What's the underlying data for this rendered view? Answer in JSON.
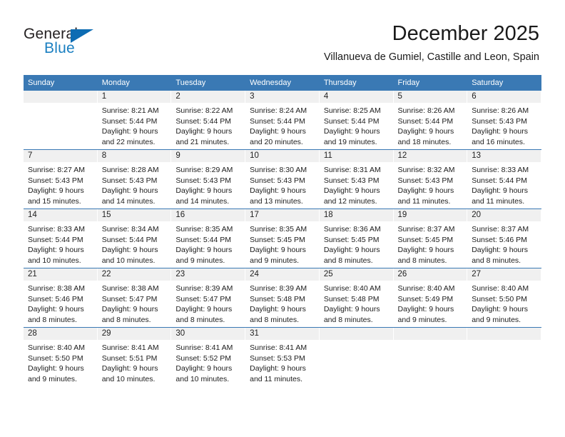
{
  "brand": {
    "word1": "General",
    "word2": "Blue",
    "triangle_color": "#0d6cb3",
    "word1_color": "#231f20",
    "word2_color": "#1a7fc1"
  },
  "header": {
    "title": "December 2025",
    "subtitle": "Villanueva de Gumiel, Castille and Leon, Spain"
  },
  "theme": {
    "header_blue": "#3a79b4",
    "daynum_band_gray": "#f0f0f0",
    "text_color": "#1c1c1c"
  },
  "calendar": {
    "weekday_headers": [
      "Sunday",
      "Monday",
      "Tuesday",
      "Wednesday",
      "Thursday",
      "Friday",
      "Saturday"
    ],
    "weeks": [
      [
        {
          "day": "",
          "sunrise": "",
          "sunset": "",
          "daylight1": "",
          "daylight2": ""
        },
        {
          "day": "1",
          "sunrise": "Sunrise: 8:21 AM",
          "sunset": "Sunset: 5:44 PM",
          "daylight1": "Daylight: 9 hours",
          "daylight2": "and 22 minutes."
        },
        {
          "day": "2",
          "sunrise": "Sunrise: 8:22 AM",
          "sunset": "Sunset: 5:44 PM",
          "daylight1": "Daylight: 9 hours",
          "daylight2": "and 21 minutes."
        },
        {
          "day": "3",
          "sunrise": "Sunrise: 8:24 AM",
          "sunset": "Sunset: 5:44 PM",
          "daylight1": "Daylight: 9 hours",
          "daylight2": "and 20 minutes."
        },
        {
          "day": "4",
          "sunrise": "Sunrise: 8:25 AM",
          "sunset": "Sunset: 5:44 PM",
          "daylight1": "Daylight: 9 hours",
          "daylight2": "and 19 minutes."
        },
        {
          "day": "5",
          "sunrise": "Sunrise: 8:26 AM",
          "sunset": "Sunset: 5:44 PM",
          "daylight1": "Daylight: 9 hours",
          "daylight2": "and 18 minutes."
        },
        {
          "day": "6",
          "sunrise": "Sunrise: 8:26 AM",
          "sunset": "Sunset: 5:43 PM",
          "daylight1": "Daylight: 9 hours",
          "daylight2": "and 16 minutes."
        }
      ],
      [
        {
          "day": "7",
          "sunrise": "Sunrise: 8:27 AM",
          "sunset": "Sunset: 5:43 PM",
          "daylight1": "Daylight: 9 hours",
          "daylight2": "and 15 minutes."
        },
        {
          "day": "8",
          "sunrise": "Sunrise: 8:28 AM",
          "sunset": "Sunset: 5:43 PM",
          "daylight1": "Daylight: 9 hours",
          "daylight2": "and 14 minutes."
        },
        {
          "day": "9",
          "sunrise": "Sunrise: 8:29 AM",
          "sunset": "Sunset: 5:43 PM",
          "daylight1": "Daylight: 9 hours",
          "daylight2": "and 14 minutes."
        },
        {
          "day": "10",
          "sunrise": "Sunrise: 8:30 AM",
          "sunset": "Sunset: 5:43 PM",
          "daylight1": "Daylight: 9 hours",
          "daylight2": "and 13 minutes."
        },
        {
          "day": "11",
          "sunrise": "Sunrise: 8:31 AM",
          "sunset": "Sunset: 5:43 PM",
          "daylight1": "Daylight: 9 hours",
          "daylight2": "and 12 minutes."
        },
        {
          "day": "12",
          "sunrise": "Sunrise: 8:32 AM",
          "sunset": "Sunset: 5:43 PM",
          "daylight1": "Daylight: 9 hours",
          "daylight2": "and 11 minutes."
        },
        {
          "day": "13",
          "sunrise": "Sunrise: 8:33 AM",
          "sunset": "Sunset: 5:44 PM",
          "daylight1": "Daylight: 9 hours",
          "daylight2": "and 11 minutes."
        }
      ],
      [
        {
          "day": "14",
          "sunrise": "Sunrise: 8:33 AM",
          "sunset": "Sunset: 5:44 PM",
          "daylight1": "Daylight: 9 hours",
          "daylight2": "and 10 minutes."
        },
        {
          "day": "15",
          "sunrise": "Sunrise: 8:34 AM",
          "sunset": "Sunset: 5:44 PM",
          "daylight1": "Daylight: 9 hours",
          "daylight2": "and 10 minutes."
        },
        {
          "day": "16",
          "sunrise": "Sunrise: 8:35 AM",
          "sunset": "Sunset: 5:44 PM",
          "daylight1": "Daylight: 9 hours",
          "daylight2": "and 9 minutes."
        },
        {
          "day": "17",
          "sunrise": "Sunrise: 8:35 AM",
          "sunset": "Sunset: 5:45 PM",
          "daylight1": "Daylight: 9 hours",
          "daylight2": "and 9 minutes."
        },
        {
          "day": "18",
          "sunrise": "Sunrise: 8:36 AM",
          "sunset": "Sunset: 5:45 PM",
          "daylight1": "Daylight: 9 hours",
          "daylight2": "and 8 minutes."
        },
        {
          "day": "19",
          "sunrise": "Sunrise: 8:37 AM",
          "sunset": "Sunset: 5:45 PM",
          "daylight1": "Daylight: 9 hours",
          "daylight2": "and 8 minutes."
        },
        {
          "day": "20",
          "sunrise": "Sunrise: 8:37 AM",
          "sunset": "Sunset: 5:46 PM",
          "daylight1": "Daylight: 9 hours",
          "daylight2": "and 8 minutes."
        }
      ],
      [
        {
          "day": "21",
          "sunrise": "Sunrise: 8:38 AM",
          "sunset": "Sunset: 5:46 PM",
          "daylight1": "Daylight: 9 hours",
          "daylight2": "and 8 minutes."
        },
        {
          "day": "22",
          "sunrise": "Sunrise: 8:38 AM",
          "sunset": "Sunset: 5:47 PM",
          "daylight1": "Daylight: 9 hours",
          "daylight2": "and 8 minutes."
        },
        {
          "day": "23",
          "sunrise": "Sunrise: 8:39 AM",
          "sunset": "Sunset: 5:47 PM",
          "daylight1": "Daylight: 9 hours",
          "daylight2": "and 8 minutes."
        },
        {
          "day": "24",
          "sunrise": "Sunrise: 8:39 AM",
          "sunset": "Sunset: 5:48 PM",
          "daylight1": "Daylight: 9 hours",
          "daylight2": "and 8 minutes."
        },
        {
          "day": "25",
          "sunrise": "Sunrise: 8:40 AM",
          "sunset": "Sunset: 5:48 PM",
          "daylight1": "Daylight: 9 hours",
          "daylight2": "and 8 minutes."
        },
        {
          "day": "26",
          "sunrise": "Sunrise: 8:40 AM",
          "sunset": "Sunset: 5:49 PM",
          "daylight1": "Daylight: 9 hours",
          "daylight2": "and 9 minutes."
        },
        {
          "day": "27",
          "sunrise": "Sunrise: 8:40 AM",
          "sunset": "Sunset: 5:50 PM",
          "daylight1": "Daylight: 9 hours",
          "daylight2": "and 9 minutes."
        }
      ],
      [
        {
          "day": "28",
          "sunrise": "Sunrise: 8:40 AM",
          "sunset": "Sunset: 5:50 PM",
          "daylight1": "Daylight: 9 hours",
          "daylight2": "and 9 minutes."
        },
        {
          "day": "29",
          "sunrise": "Sunrise: 8:41 AM",
          "sunset": "Sunset: 5:51 PM",
          "daylight1": "Daylight: 9 hours",
          "daylight2": "and 10 minutes."
        },
        {
          "day": "30",
          "sunrise": "Sunrise: 8:41 AM",
          "sunset": "Sunset: 5:52 PM",
          "daylight1": "Daylight: 9 hours",
          "daylight2": "and 10 minutes."
        },
        {
          "day": "31",
          "sunrise": "Sunrise: 8:41 AM",
          "sunset": "Sunset: 5:53 PM",
          "daylight1": "Daylight: 9 hours",
          "daylight2": "and 11 minutes."
        },
        {
          "day": "",
          "sunrise": "",
          "sunset": "",
          "daylight1": "",
          "daylight2": ""
        },
        {
          "day": "",
          "sunrise": "",
          "sunset": "",
          "daylight1": "",
          "daylight2": ""
        },
        {
          "day": "",
          "sunrise": "",
          "sunset": "",
          "daylight1": "",
          "daylight2": ""
        }
      ]
    ]
  }
}
